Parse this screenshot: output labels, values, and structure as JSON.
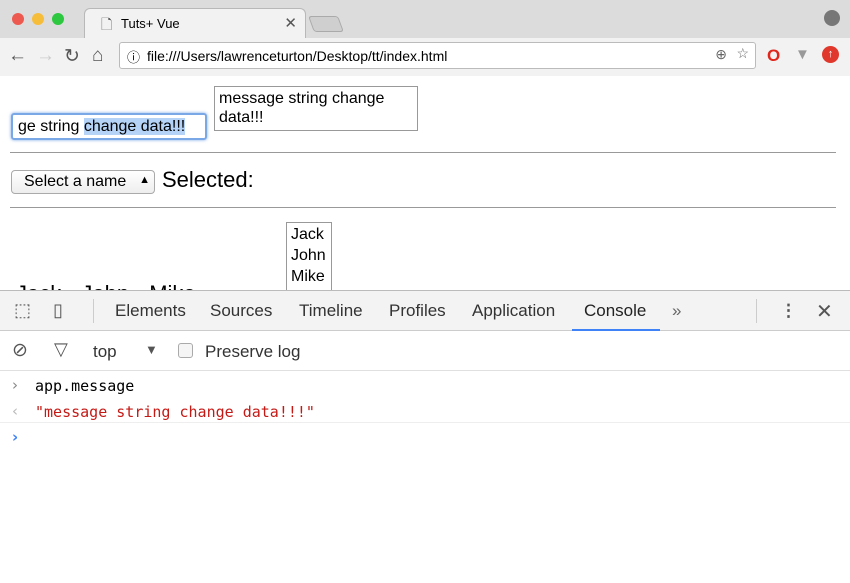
{
  "browser": {
    "tab_title": "Tuts+ Vue",
    "url": "file:///Users/lawrenceturton/Desktop/tt/index.html",
    "traffic_lights": [
      "#ed594f",
      "#f6bd3b",
      "#2dc840"
    ]
  },
  "page": {
    "input_value_prefix": "ge string ",
    "input_value_selected": "change data!!!",
    "textarea_value": "message string change data!!!",
    "select_value": "Select a name",
    "selected_label": "Selected:",
    "listbox_options": [
      "Jack",
      "John",
      "Mike"
    ],
    "checkbox_labels": [
      "Jack",
      "John",
      "Mike"
    ]
  },
  "devtools": {
    "tabs": [
      "Elements",
      "Sources",
      "Timeline",
      "Profiles",
      "Application",
      "Console"
    ],
    "active_tab": "Console",
    "more": "»",
    "context": "top",
    "preserve_log": "Preserve log",
    "console": {
      "input": "app.message",
      "output": "\"message string change data!!!\""
    },
    "accent": "#3f82f7"
  }
}
